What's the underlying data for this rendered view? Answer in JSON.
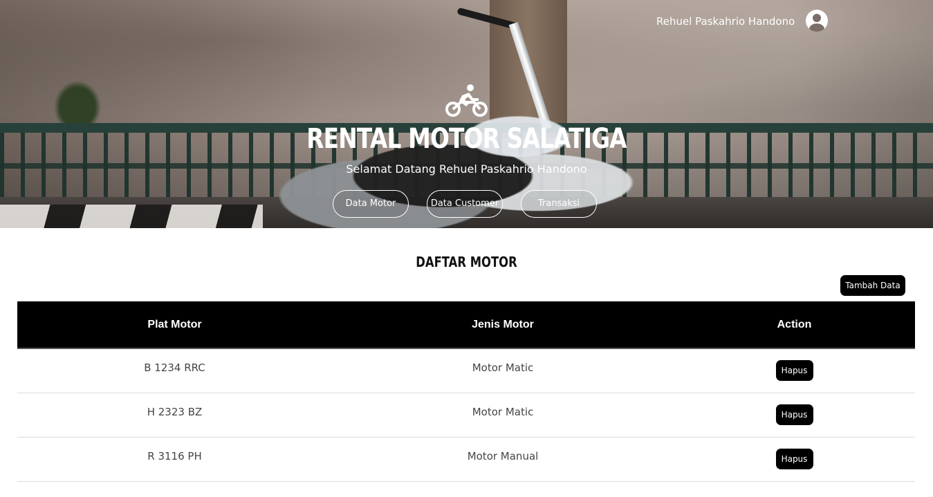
{
  "header": {
    "user_name": "Rehuel Paskahrio Handono",
    "avatar_icon": "user-circle-icon",
    "brand_icon": "motorcycle-rider-icon",
    "brand_title": "RENTAL MOTOR SALATIGA",
    "welcome_text": "Selamat Datang Rehuel Paskahrio Handono",
    "nav": [
      {
        "label": "Data Motor"
      },
      {
        "label": "Data Customer"
      },
      {
        "label": "Transaksi"
      }
    ]
  },
  "main": {
    "title": "DAFTAR MOTOR",
    "add_button": "Tambah Data",
    "table": {
      "columns": [
        "Plat Motor",
        "Jenis Motor",
        "Action"
      ],
      "rows": [
        {
          "plat": "B 1234 RRC",
          "jenis": "Motor Matic",
          "action": "Hapus"
        },
        {
          "plat": "H 2323 BZ",
          "jenis": "Motor Matic",
          "action": "Hapus"
        },
        {
          "plat": "R 3116 PH",
          "jenis": "Motor Manual",
          "action": "Hapus"
        }
      ]
    }
  },
  "colors": {
    "header_text": "#ffffff",
    "table_header_bg": "#000000",
    "button_bg": "#000000"
  }
}
